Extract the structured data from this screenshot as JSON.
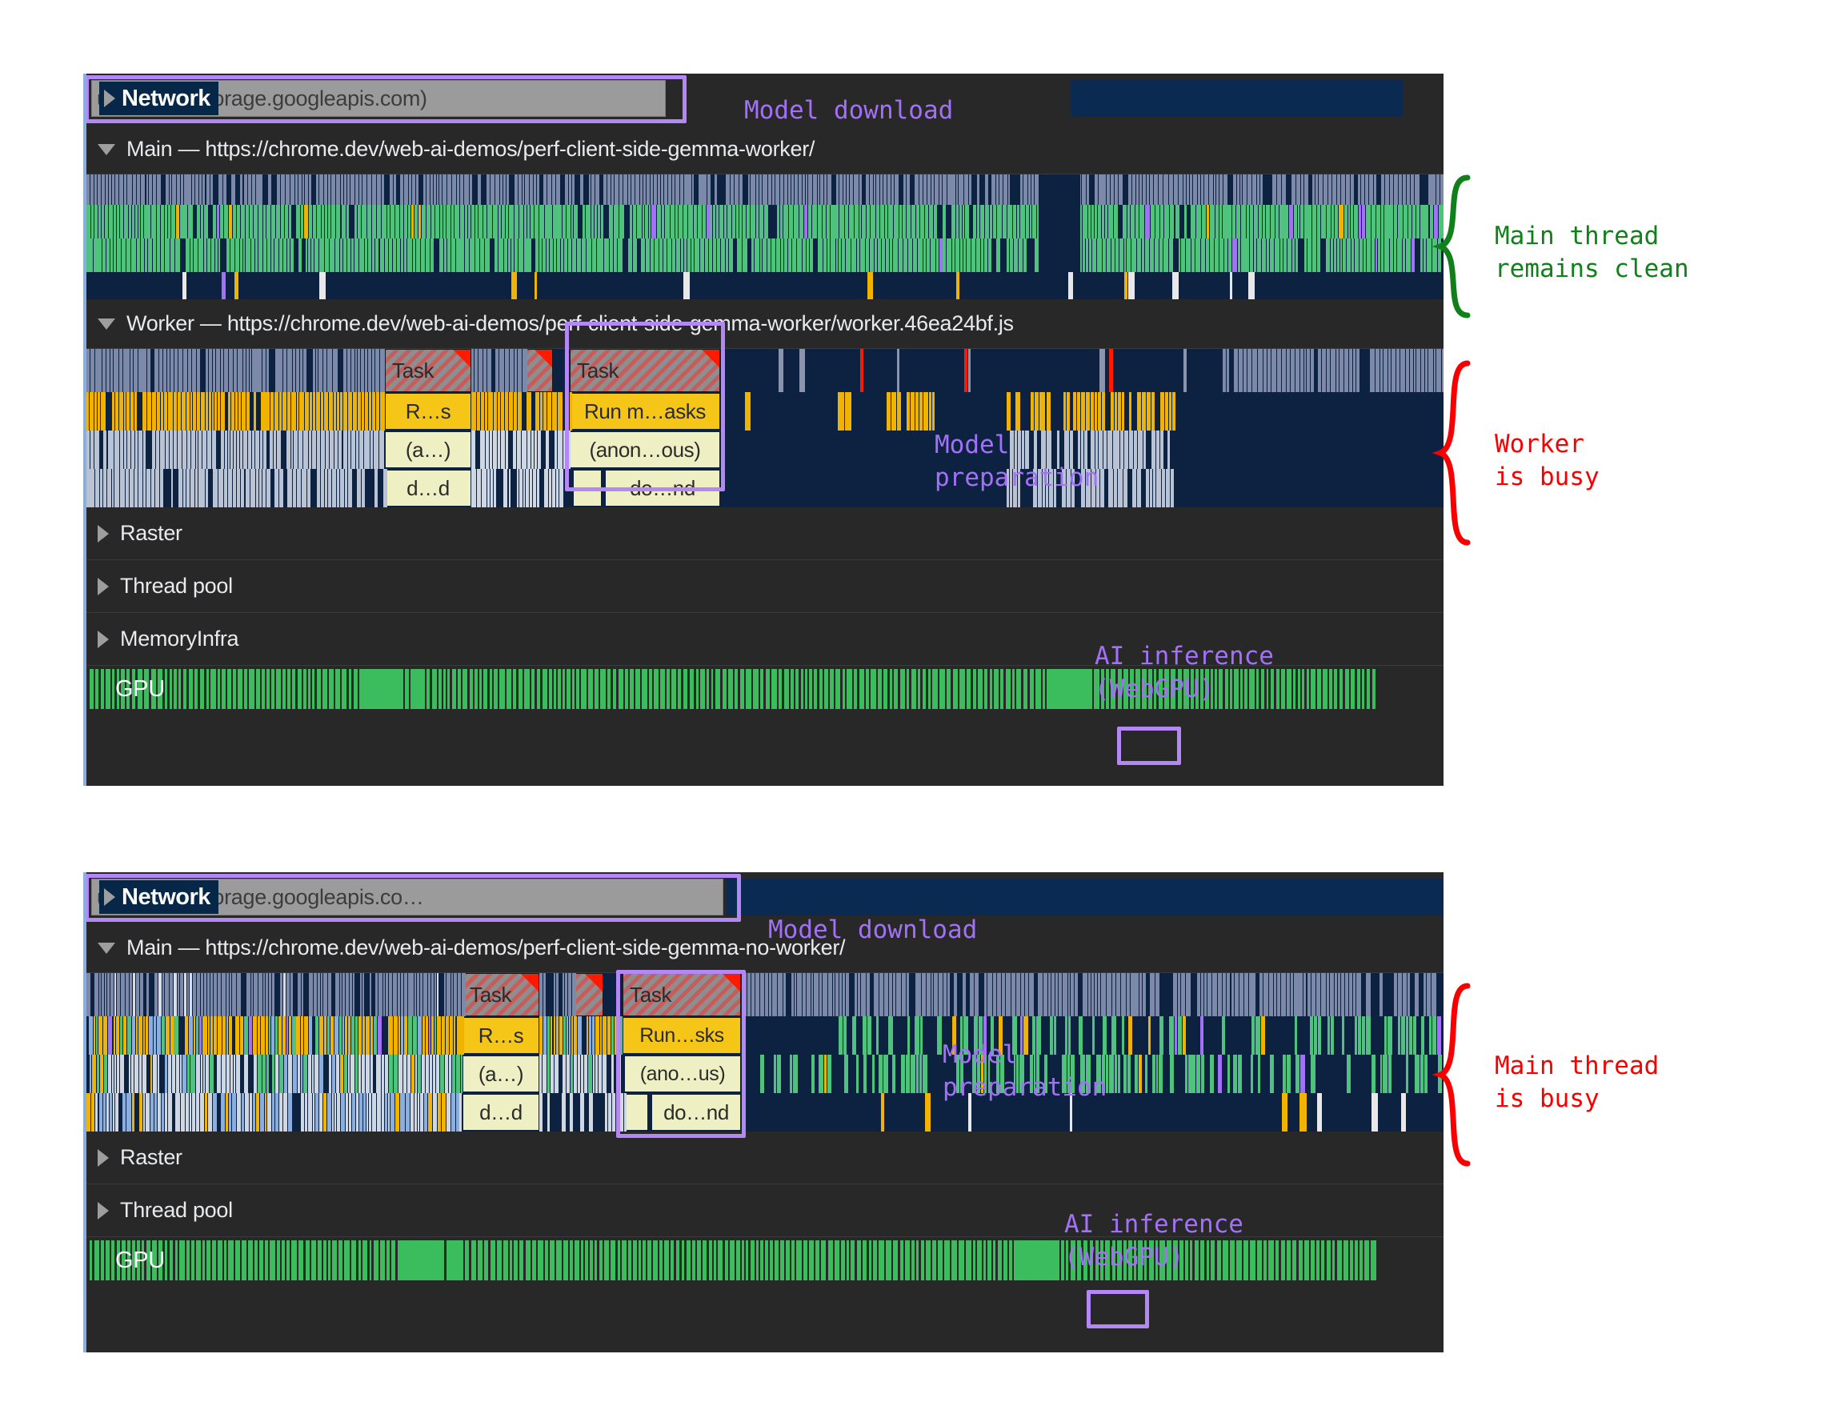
{
  "meta": {
    "tool": "Chrome DevTools Performance panel",
    "comparison": "web worker vs no worker"
  },
  "colors": {
    "highlight_purple": "#b388f5",
    "annotation_purple": "#a371f7",
    "annotation_green": "#11801a",
    "annotation_red": "#f80000",
    "panel_bg": "#282828",
    "track_blue": "#0d2240",
    "bar_yellow": "#f5c518",
    "bar_cream": "#eef0c4",
    "gpu_green": "#3bbd5e",
    "network_pill_bg": "#062748",
    "network_request_bg": "#9b9b9b"
  },
  "panels": [
    {
      "id": "worker",
      "network": {
        "pill_label": "Network",
        "request_label": "u-int4.bin (storage.googleapis.com)",
        "expand_icon": "triangle-right-icon"
      },
      "main_track": {
        "title": "Main — https://chrome.dev/web-ai-demos/perf-client-side-gemma-worker/",
        "collapse_icon": "triangle-down-icon"
      },
      "worker_track": {
        "title": "Worker — https://chrome.dev/web-ai-demos/perf-client-side-gemma-worker/worker.46ea24bf.js",
        "collapse_icon": "triangle-down-icon",
        "flame_labels": {
          "task_1": "Task",
          "task_2": "Task",
          "run_1": "R…s",
          "run_2": "Run m…asks",
          "anon_1": "(a…)",
          "anon_2": "(anon…ous)",
          "down_1": "d…d",
          "down_2": "do…nd"
        }
      },
      "collapsed_tracks": [
        {
          "label": "Raster",
          "expand_icon": "triangle-right-icon"
        },
        {
          "label": "Thread pool",
          "expand_icon": "triangle-right-icon"
        },
        {
          "label": "MemoryInfra",
          "expand_icon": "triangle-right-icon"
        }
      ],
      "gpu_track": {
        "label": "GPU"
      },
      "annotations": [
        {
          "name": "model-download",
          "text": "Model download",
          "color": "purple"
        },
        {
          "name": "main-thread-clean",
          "text": "Main thread\nremains clean",
          "color": "green",
          "brace": "green"
        },
        {
          "name": "worker-busy",
          "text": "Worker\nis busy",
          "color": "red",
          "brace": "red"
        },
        {
          "name": "model-preparation",
          "text": "Model\npreparation",
          "color": "purple"
        },
        {
          "name": "ai-inference",
          "text": "AI inference\n(WebGPU)",
          "color": "purple"
        }
      ]
    },
    {
      "id": "no-worker",
      "network": {
        "pill_label": "Network",
        "request_label": "u-int4.bin (storage.googleapis.co…",
        "expand_icon": "triangle-right-icon"
      },
      "main_track": {
        "title": "Main — https://chrome.dev/web-ai-demos/perf-client-side-gemma-no-worker/",
        "collapse_icon": "triangle-down-icon",
        "flame_labels": {
          "task_1": "Task",
          "task_2": "Task",
          "run_1": "R…s",
          "run_2": "Run…sks",
          "anon_1": "(a…)",
          "anon_2": "(ano…us)",
          "down_1": "d…d",
          "down_2": "do…nd"
        }
      },
      "collapsed_tracks": [
        {
          "label": "Raster",
          "expand_icon": "triangle-right-icon"
        },
        {
          "label": "Thread pool",
          "expand_icon": "triangle-right-icon"
        }
      ],
      "gpu_track": {
        "label": "GPU"
      },
      "annotations": [
        {
          "name": "model-download",
          "text": "Model download",
          "color": "purple"
        },
        {
          "name": "main-thread-busy",
          "text": "Main thread\nis busy",
          "color": "red",
          "brace": "red"
        },
        {
          "name": "model-preparation",
          "text": "Model\npreparation",
          "color": "purple"
        },
        {
          "name": "ai-inference",
          "text": "AI inference\n(WebGPU)",
          "color": "purple"
        }
      ]
    }
  ]
}
